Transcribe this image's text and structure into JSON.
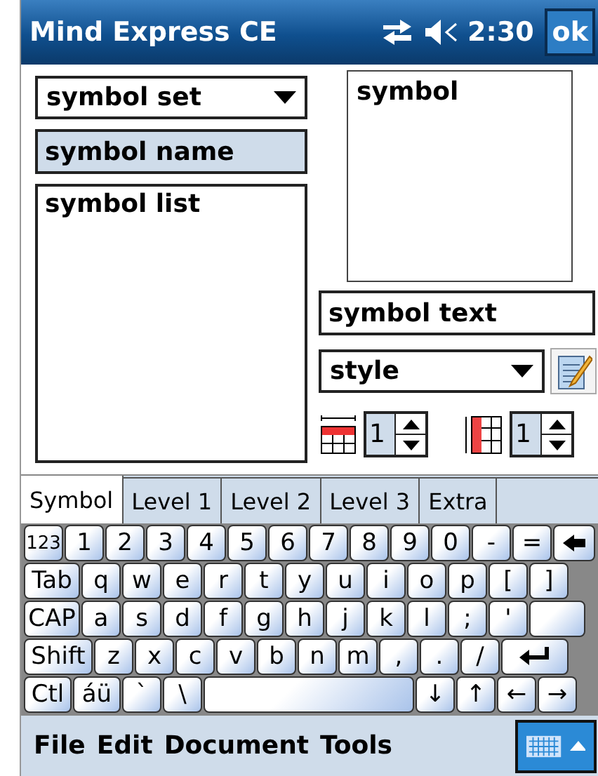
{
  "title_bar": {
    "title": "Mind Express CE",
    "time": "2:30",
    "ok": "ok"
  },
  "symbol_set": {
    "value": "symbol set"
  },
  "symbol_name": {
    "placeholder": "symbol name"
  },
  "symbol_list": {
    "label": "symbol list"
  },
  "symbol_preview": {
    "label": "symbol"
  },
  "symbol_text": {
    "placeholder": "symbol text"
  },
  "style": {
    "value": "style"
  },
  "rows_spinner": {
    "value": "1"
  },
  "columns_spinner": {
    "value": "1"
  },
  "tabs": [
    {
      "label": "Symbol",
      "selected": true
    },
    {
      "label": "Level 1",
      "selected": false
    },
    {
      "label": "Level 2",
      "selected": false
    },
    {
      "label": "Level 3",
      "selected": false
    },
    {
      "label": "Extra",
      "selected": false
    }
  ],
  "keyboard": [
    [
      {
        "kind": "small",
        "label": "123"
      },
      {
        "kind": "char",
        "label": "1"
      },
      {
        "kind": "char",
        "label": "2"
      },
      {
        "kind": "char",
        "label": "3"
      },
      {
        "kind": "char",
        "label": "4"
      },
      {
        "kind": "char",
        "label": "5"
      },
      {
        "kind": "char",
        "label": "6"
      },
      {
        "kind": "char",
        "label": "7"
      },
      {
        "kind": "char",
        "label": "8"
      },
      {
        "kind": "char",
        "label": "9"
      },
      {
        "kind": "char",
        "label": "0"
      },
      {
        "kind": "char",
        "label": "-"
      },
      {
        "kind": "char",
        "label": "="
      },
      {
        "kind": "backspace"
      }
    ],
    [
      {
        "kind": "mod",
        "label": "Tab"
      },
      {
        "kind": "char",
        "label": "q"
      },
      {
        "kind": "char",
        "label": "w"
      },
      {
        "kind": "char",
        "label": "e"
      },
      {
        "kind": "char",
        "label": "r"
      },
      {
        "kind": "char",
        "label": "t"
      },
      {
        "kind": "char",
        "label": "y"
      },
      {
        "kind": "char",
        "label": "u"
      },
      {
        "kind": "char",
        "label": "i"
      },
      {
        "kind": "char",
        "label": "o"
      },
      {
        "kind": "char",
        "label": "p"
      },
      {
        "kind": "char",
        "label": "["
      },
      {
        "kind": "char",
        "label": "]"
      }
    ],
    [
      {
        "kind": "mod",
        "label": "CAP"
      },
      {
        "kind": "char",
        "label": "a"
      },
      {
        "kind": "char",
        "label": "s"
      },
      {
        "kind": "char",
        "label": "d"
      },
      {
        "kind": "char",
        "label": "f"
      },
      {
        "kind": "char",
        "label": "g"
      },
      {
        "kind": "char",
        "label": "h"
      },
      {
        "kind": "char",
        "label": "j"
      },
      {
        "kind": "char",
        "label": "k"
      },
      {
        "kind": "char",
        "label": "l"
      },
      {
        "kind": "char",
        "label": ";"
      },
      {
        "kind": "char",
        "label": "'"
      },
      {
        "kind": "enter_top"
      }
    ],
    [
      {
        "kind": "wide",
        "label": "Shift"
      },
      {
        "kind": "char",
        "label": "z"
      },
      {
        "kind": "char",
        "label": "x"
      },
      {
        "kind": "char",
        "label": "c"
      },
      {
        "kind": "char",
        "label": "v"
      },
      {
        "kind": "char",
        "label": "b"
      },
      {
        "kind": "char",
        "label": "n"
      },
      {
        "kind": "char",
        "label": "m"
      },
      {
        "kind": "char",
        "label": ","
      },
      {
        "kind": "char",
        "label": "."
      },
      {
        "kind": "char",
        "label": "/"
      },
      {
        "kind": "enter"
      }
    ],
    [
      {
        "kind": "char",
        "label": "Ctl"
      },
      {
        "kind": "char",
        "label": "áü"
      },
      {
        "kind": "char",
        "label": "`"
      },
      {
        "kind": "char",
        "label": "\\"
      },
      {
        "kind": "space"
      },
      {
        "kind": "char",
        "label": "↓"
      },
      {
        "kind": "char",
        "label": "↑"
      },
      {
        "kind": "char",
        "label": "←"
      },
      {
        "kind": "char",
        "label": "→"
      }
    ]
  ],
  "menu": [
    "File",
    "Edit",
    "Document",
    "Tools"
  ]
}
